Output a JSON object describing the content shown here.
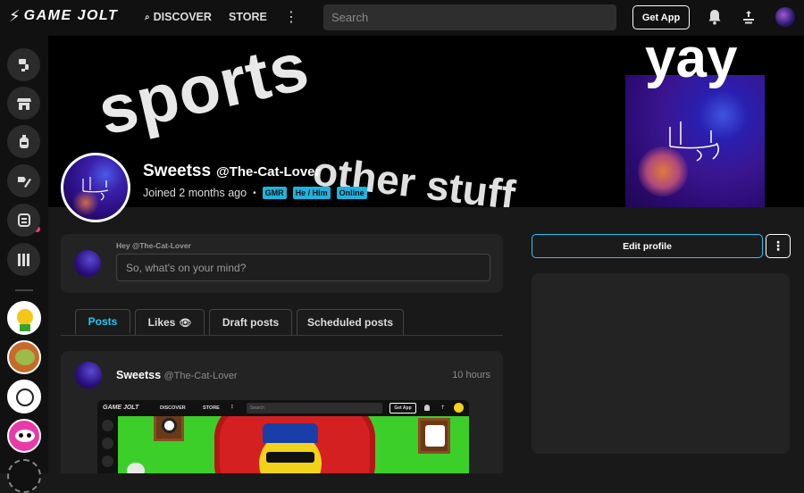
{
  "header": {
    "logo_text": "GAME JOLT",
    "nav_discover": "DISCOVER",
    "nav_store": "STORE",
    "more_icon": "⋮",
    "search_placeholder": "Search",
    "get_app": "Get App"
  },
  "banner": {
    "text_sports": "sports",
    "text_other": "other stuff",
    "text_yay": "yay"
  },
  "profile": {
    "display_name": "Sweetss",
    "handle": "@The-Cat-Lover",
    "joined": "Joined 2 months ago",
    "separator": "•",
    "tags": [
      "GMR",
      "He / Him",
      "Online"
    ]
  },
  "composer": {
    "greeting": "Hey @The-Cat-Lover",
    "placeholder": "So, what's on your mind?"
  },
  "tabs": [
    {
      "label": "Posts"
    },
    {
      "label": "Likes"
    },
    {
      "label": "Draft posts"
    },
    {
      "label": "Scheduled posts"
    }
  ],
  "post": {
    "author": "Sweetss",
    "handle": "@The-Cat-Lover",
    "time": "10 hours"
  },
  "embedded": {
    "logo": "GAME JOLT",
    "discover": "DISCOVER",
    "store": "STORE",
    "more": "⋮",
    "search": "Search",
    "get_app": "Get App"
  },
  "sidebar_actions": {
    "edit_profile": "Edit profile",
    "more_icon": "⋮"
  },
  "colors": {
    "accent": "#28c6f4",
    "tag_bg": "#1fb3e0",
    "notification_dot": "#ff3c6b"
  }
}
